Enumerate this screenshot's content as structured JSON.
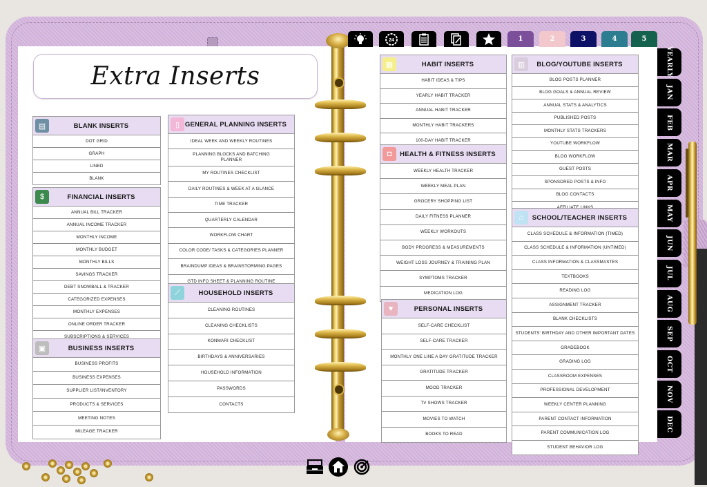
{
  "page_title": "Extra Inserts",
  "top_tabs": {
    "icon_tabs": [
      {
        "name": "lightbulb-icon",
        "glyph": "💡"
      },
      {
        "name": "clock-24-icon",
        "glyph": "24"
      },
      {
        "name": "clipboard-icon",
        "glyph": "📋"
      },
      {
        "name": "notes-edit-icon",
        "glyph": "📝"
      },
      {
        "name": "star-icon",
        "glyph": "★"
      }
    ],
    "number_tabs": [
      {
        "label": "1",
        "color": "#7b4f9a"
      },
      {
        "label": "2",
        "color": "#f2c8cc"
      },
      {
        "label": "3",
        "color": "#0d1266"
      },
      {
        "label": "4",
        "color": "#2c7d8f"
      },
      {
        "label": "5",
        "color": "#14614d"
      }
    ]
  },
  "month_tabs": [
    "YEARLY",
    "JAN",
    "FEB",
    "MAR",
    "APR",
    "MAY",
    "JUN",
    "JUL",
    "AUG",
    "SEP",
    "OCT",
    "NOV",
    "DEC"
  ],
  "sections": {
    "blank": {
      "title": "BLANK INSERTS",
      "icon": "notebook-icon",
      "icon_color": "#6f8fa3",
      "items": [
        "DOT GRID",
        "GRAPH",
        "LINED",
        "BLANK"
      ]
    },
    "financial": {
      "title": "FINANCIAL INSERTS",
      "icon": "money-icon",
      "icon_color": "#3c8a4e",
      "items": [
        "ANNUAL BILL TRACKER",
        "ANNUAL INCOME TRACKER",
        "MONTHLY INCOME",
        "MONTHLY BUDGET",
        "MONTHLY BILLS",
        "SAVINGS TRACKER",
        "DEBT SNOWBALL & TRACKER",
        "CATEGORIZED EXPENSES",
        "MONTHLY EXPENSES",
        "ONLINE ORDER TRACKER",
        "SUBSCRIPTIONS & SERVICES"
      ]
    },
    "business": {
      "title": "BUSINESS INSERTS",
      "icon": "briefcase-icon",
      "icon_color": "#bdbdbd",
      "items": [
        "BUSINESS PROFITS",
        "BUSINESS EXPENSES",
        "SUPPLIER LIST/INVENTORY",
        "PRODUCTS & SERVICES",
        "MEETING NOTES",
        "MILEAGE TRACKER"
      ]
    },
    "general_planning": {
      "title": "GENERAL PLANNING INSERTS",
      "icon": "planner-icon",
      "icon_color": "#f3b7d8",
      "items": [
        "IDEAL WEEK AND WEEKLY ROUTINES",
        "PLANNING BLOCKS AND BATCHING PLANNER",
        "MY ROUTINES CHECKLIST",
        "DAILY ROUTINES & WEEK AT A GLANCE",
        "TIME TRACKER",
        "QUARTERLY CALENDAR",
        "WORKFLOW CHART",
        "COLOR CODE/ TASKS & CATEGORIES PLANNER",
        "BRAINDUMP IDEAS & BRAINSTORMING PAGES",
        "GTD INFO SHEET & PLANNING ROUTINE"
      ]
    },
    "household": {
      "title": "HOUSEHOLD INSERTS",
      "icon": "cleaning-brush-icon",
      "icon_color": "#8fd3dc",
      "items": [
        "CLEANING ROUTINES",
        "CLEANING CHECKLISTS",
        "KONMARI CHECKLIST",
        "BIRTHDAYS & ANNIVERSARIES",
        "HOUSEHOLD INFORMATION",
        "PASSWORDS",
        "CONTACTS"
      ]
    },
    "habit": {
      "title": "HABIT INSERTS",
      "icon": "calendar-icon",
      "icon_color": "#f5ef8a",
      "items": [
        "HABIT IDEAS & TIPS",
        "YEARLY HABIT TRACKER",
        "ANNUAL HABIT TRACKER",
        "MONTHLY HABIT TRACKERS",
        "100-DAY HABIT TRACKER"
      ]
    },
    "health": {
      "title": "HEALTH & FITNESS INSERTS",
      "icon": "fitness-watch-icon",
      "icon_color": "#f29a9a",
      "items": [
        "WEEKLY HEALTH TRACKER",
        "WEEKLY MEAL PLAN",
        "GROCERY SHOPPING LIST",
        "DAILY FITNESS PLANNER",
        "WEEKLY WORKOUTS",
        "BODY PROGRESS & MEASUREMENTS",
        "WEIGHT LOSS JOURNEY & TRAINING PLAN",
        "SYMPTOMS TRACKER",
        "MEDICATION LOG"
      ]
    },
    "personal": {
      "title": "PERSONAL INSERTS",
      "icon": "heart-icon",
      "icon_color": "#e8b4bf",
      "items": [
        "SELF-CARE CHECKLIST",
        "SELF-CARE TRACKER",
        "MONTHLY ONE LINE A DAY GRATITUDE TRACKER",
        "GRATITUDE TRACKER",
        "MOOD TRACKER",
        "TV SHOWS TRACKER",
        "MOVIES TO WATCH",
        "BOOKS TO READ"
      ]
    },
    "blog": {
      "title": "BLOG/YOUTUBE INSERTS",
      "icon": "blog-layout-icon",
      "icon_color": "#d9ccdc",
      "items": [
        "BLOG POSTS PLANNER",
        "BLOG GOALS & ANNUAL REVIEW",
        "ANNUAL STATS & ANALYTICS",
        "PUBLISHED POSTS",
        "MONTHLY STATS TRACKERS",
        "YOUTUBE WORKFLOW",
        "BLOG WORKFLOW",
        "GUEST POSTS",
        "SPONSORED POSTS & INFO",
        "BLOG CONTACTS",
        "AFFILIATE LINKS"
      ]
    },
    "school": {
      "title": "SCHOOL/TEACHER INSERTS",
      "icon": "school-building-icon",
      "icon_color": "#bfe3f2",
      "items": [
        "CLASS SCHEDULE & INFORMATION (TIMED)",
        "CLASS SCHEDULE & INFORMATION (UNTIMED)",
        "CLASS INFORMATION & CLASSMASTES",
        "TEXTBOOKS",
        "READING LOG",
        "ASSIGNMENT TRACKER",
        "BLANK CHECKLISTS",
        "STUDENTS' BIRTHDAY AND OTHER IMPORTANT DATES",
        "GRADEBOOK",
        "GRADING LOG",
        "CLASSROOM EXPENSES",
        "PROFESSIONAL DEVELOPMENT",
        "WEEKLY CENTER PLANNING",
        "PARENT CONTACT INFORMATION",
        "PARENT COMMUNICATION LOG",
        "STUDENT BEHAVIOR LOG"
      ]
    }
  },
  "bottom_nav": [
    {
      "name": "inbox-tray-icon",
      "glyph": "🗃"
    },
    {
      "name": "home-icon",
      "glyph": "⌂"
    },
    {
      "name": "target-icon",
      "glyph": "◎"
    }
  ]
}
